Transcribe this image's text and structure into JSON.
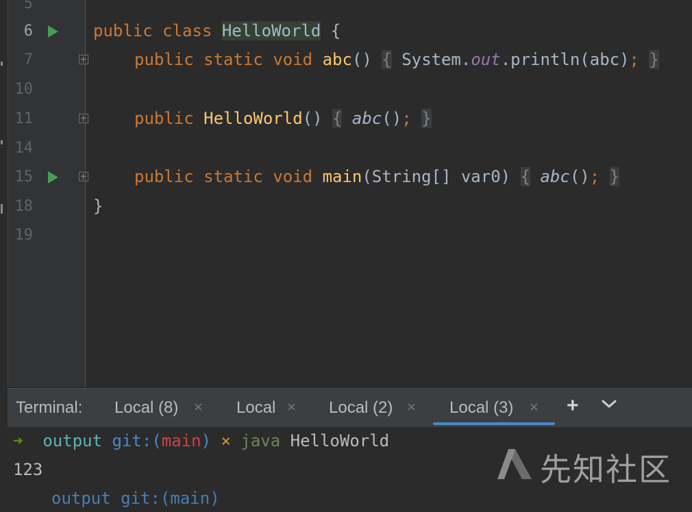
{
  "editor": {
    "lines": [
      {
        "number": "5"
      },
      {
        "number": "6"
      },
      {
        "number": "7"
      },
      {
        "number": "10"
      },
      {
        "number": "11"
      },
      {
        "number": "14"
      },
      {
        "number": "15"
      },
      {
        "number": "18"
      },
      {
        "number": "19"
      }
    ],
    "code": {
      "l6": {
        "kw1": "public",
        "kw2": "class",
        "cls": "HelloWorld",
        "brace": "{"
      },
      "l7": {
        "kw1": "public",
        "kw2": "static",
        "kw3": "void",
        "fn": "abc",
        "parens": "()",
        "ob": "{",
        "sys": "System.",
        "field": "out",
        "rest": ".println(abc)",
        "semi": ";",
        "cb": "}"
      },
      "l11": {
        "kw1": "public",
        "fn": "HelloWorld",
        "parens": "()",
        "ob": "{",
        "call": "abc",
        "callparen": "()",
        "semi": ";",
        "cb": "}"
      },
      "l15": {
        "kw1": "public",
        "kw2": "static",
        "kw3": "void",
        "fn": "main",
        "sig": "(String[] var0)",
        "ob": "{",
        "call": "abc",
        "callparen": "()",
        "semi": ";",
        "cb": "}"
      },
      "l18": {
        "brace": "}"
      }
    }
  },
  "terminal": {
    "title": "Terminal:",
    "tabs": [
      {
        "label": "Local (8)",
        "close": "×"
      },
      {
        "label": "Local",
        "close": "×"
      },
      {
        "label": "Local (2)",
        "close": "×"
      },
      {
        "label": "Local (3)",
        "close": "×"
      }
    ],
    "active_tab": "Local (3)",
    "add_label": "+",
    "prompt": {
      "arrow": "➜",
      "dir": "output",
      "git": "git:(",
      "branch": "main",
      "git_end": ")",
      "x": "×",
      "cmd": "java",
      "arg": "HelloWorld"
    },
    "output": "123",
    "partial_line": "output git:(main)"
  },
  "watermark": {
    "text": "先知社区"
  },
  "colors": {
    "keyword": "#cc7832",
    "function": "#ffc66d",
    "text": "#a9b7c6",
    "run_icon": "#499c54",
    "tab_underline": "#4a88c7"
  },
  "icons": [
    "run-icon",
    "fold-icon",
    "plus-icon",
    "chevron-down-icon",
    "close-icon"
  ]
}
